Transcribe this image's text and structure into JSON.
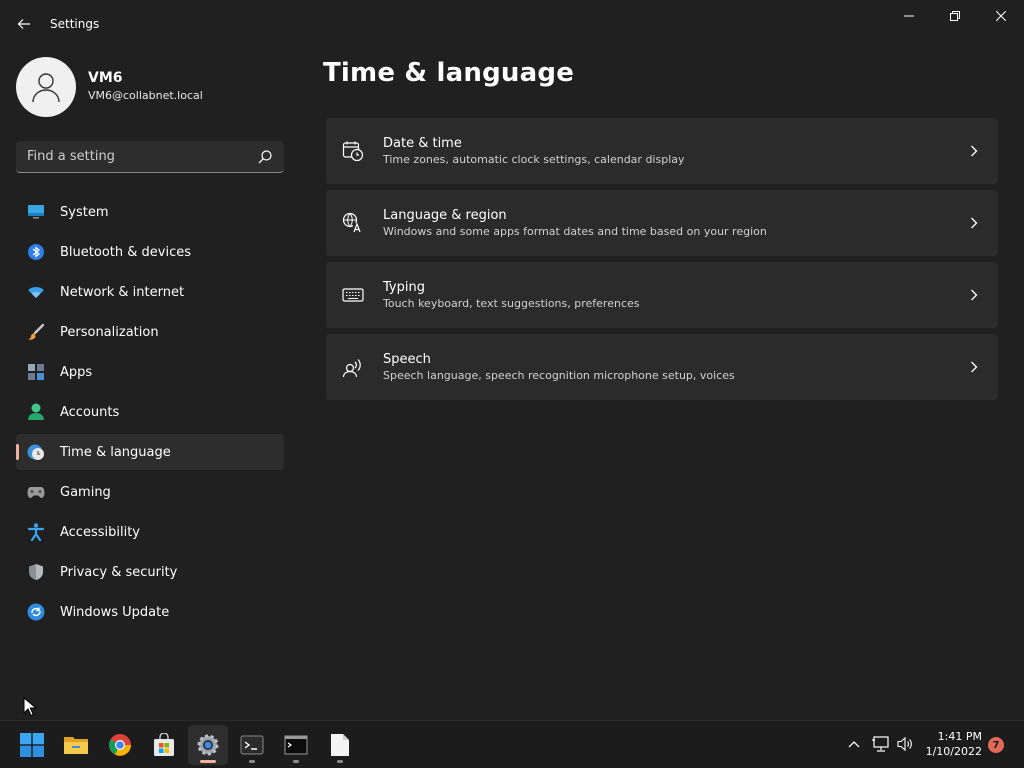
{
  "window": {
    "title": "Settings"
  },
  "profile": {
    "name": "VM6",
    "email": "VM6@collabnet.local"
  },
  "search": {
    "placeholder": "Find a setting",
    "value": ""
  },
  "nav": {
    "selected": "Time & language",
    "items": [
      {
        "label": "System",
        "icon": "monitor-icon"
      },
      {
        "label": "Bluetooth & devices",
        "icon": "bluetooth-icon"
      },
      {
        "label": "Network & internet",
        "icon": "wifi-icon"
      },
      {
        "label": "Personalization",
        "icon": "paintbrush-icon"
      },
      {
        "label": "Apps",
        "icon": "apps-grid-icon"
      },
      {
        "label": "Accounts",
        "icon": "person-icon"
      },
      {
        "label": "Time & language",
        "icon": "globe-clock-icon"
      },
      {
        "label": "Gaming",
        "icon": "gamepad-icon"
      },
      {
        "label": "Accessibility",
        "icon": "accessibility-icon"
      },
      {
        "label": "Privacy & security",
        "icon": "shield-icon"
      },
      {
        "label": "Windows Update",
        "icon": "update-icon"
      }
    ]
  },
  "main": {
    "title": "Time & language",
    "cards": [
      {
        "title": "Date & time",
        "description": "Time zones, automatic clock settings, calendar display",
        "icon": "calendar-clock-icon"
      },
      {
        "title": "Language & region",
        "description": "Windows and some apps format dates and time based on your region",
        "icon": "language-icon"
      },
      {
        "title": "Typing",
        "description": "Touch keyboard, text suggestions, preferences",
        "icon": "keyboard-icon"
      },
      {
        "title": "Speech",
        "description": "Speech language, speech recognition microphone setup, voices",
        "icon": "speech-icon"
      }
    ]
  },
  "taskbar": {
    "apps": [
      "windows-start-icon",
      "file-explorer-icon",
      "chrome-icon",
      "store-icon",
      "settings-icon",
      "terminal-icon",
      "command-prompt-icon",
      "notepad-icon"
    ],
    "active_app": "settings-icon",
    "tray": [
      "chevron-up-icon",
      "network-icon",
      "volume-icon"
    ],
    "time": "1:41 PM",
    "date": "1/10/2022",
    "notification_count": "7"
  },
  "colors": {
    "accent": "#f0b09a",
    "background": "#202020",
    "card": "#2b2b2b",
    "selected_nav": "#2d2d2d"
  }
}
